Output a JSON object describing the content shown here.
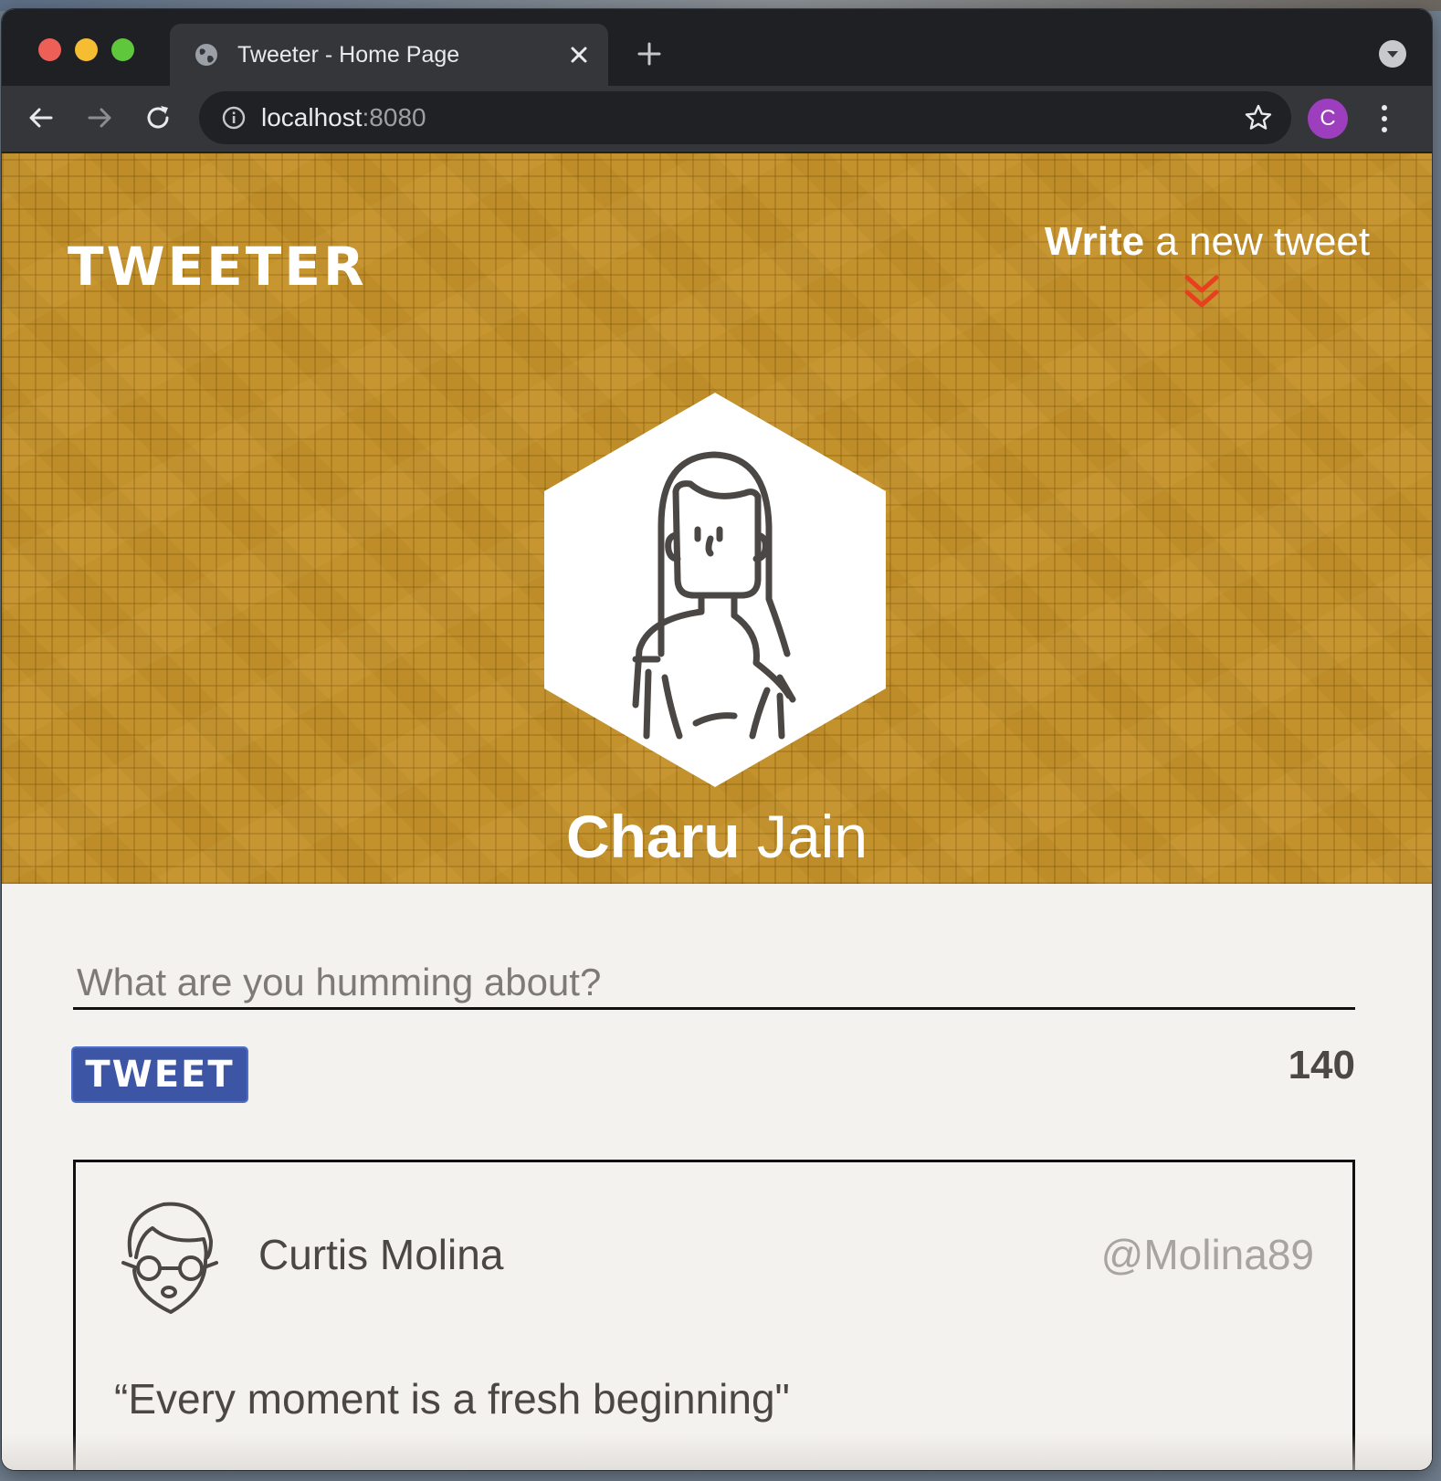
{
  "browser": {
    "tab_title": "Tweeter - Home Page",
    "url_host": "localhost",
    "url_port": ":8080",
    "profile_initial": "C"
  },
  "header": {
    "brand": "TWEETER",
    "compose_bold": "Write",
    "compose_rest": " a new tweet",
    "user_first_name": "Charu",
    "user_last_name": " Jain"
  },
  "composer": {
    "placeholder": "What are you humming about?",
    "button_label": "TWEET",
    "char_count": "140"
  },
  "tweets": [
    {
      "author": "Curtis Molina",
      "handle": "@Molina89",
      "text": "“Every moment is a fresh beginning\""
    }
  ],
  "colors": {
    "header_bg": "#c4922c",
    "tweet_button": "#3d55a5",
    "chevron_accent": "#e8401f",
    "profile_badge": "#9c3ebd"
  },
  "icons": [
    "globe-icon",
    "close-icon",
    "plus-icon",
    "tab-search-icon",
    "back-arrow-icon",
    "forward-arrow-icon",
    "reload-icon",
    "info-icon",
    "star-icon",
    "more-vert-icon",
    "chevron-double-down-icon",
    "avatar-icon"
  ]
}
